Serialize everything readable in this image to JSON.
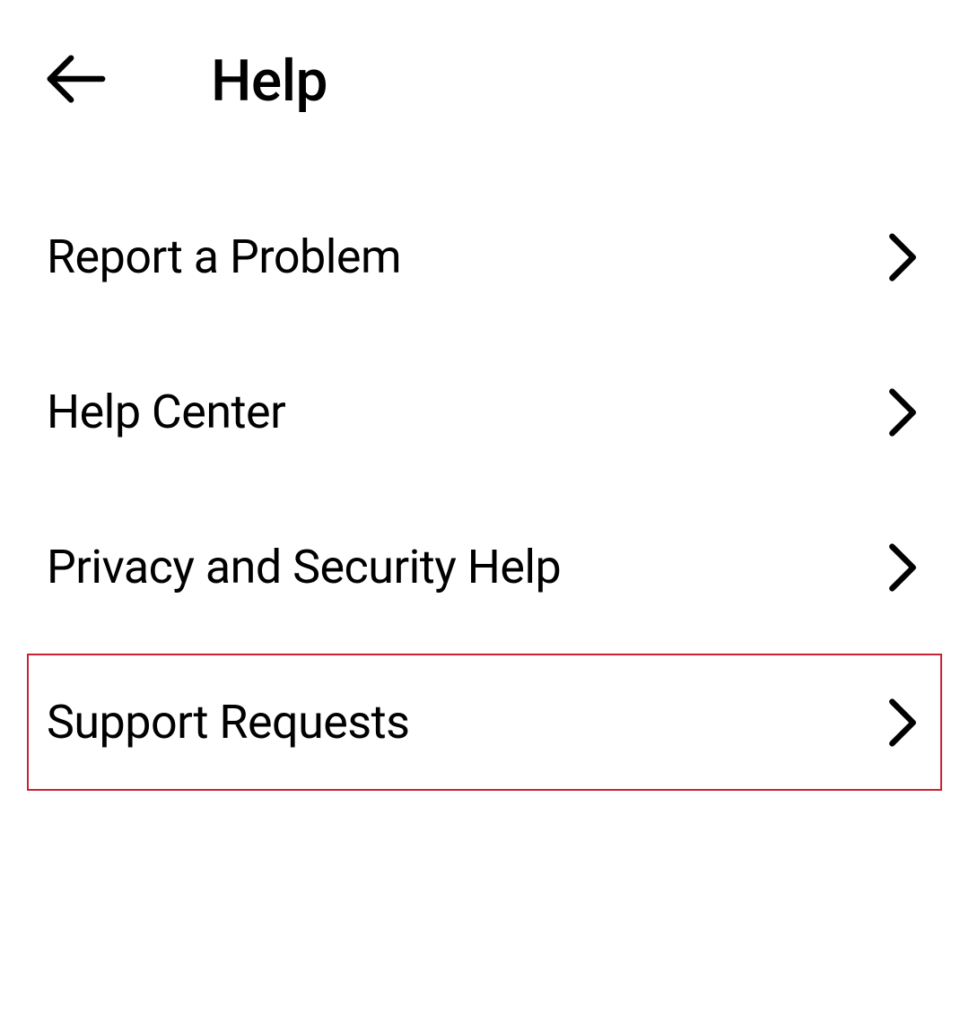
{
  "header": {
    "title": "Help"
  },
  "menu": {
    "items": [
      {
        "label": "Report a Problem",
        "highlighted": false
      },
      {
        "label": "Help Center",
        "highlighted": false
      },
      {
        "label": "Privacy and Security Help",
        "highlighted": false
      },
      {
        "label": "Support Requests",
        "highlighted": true
      }
    ]
  }
}
